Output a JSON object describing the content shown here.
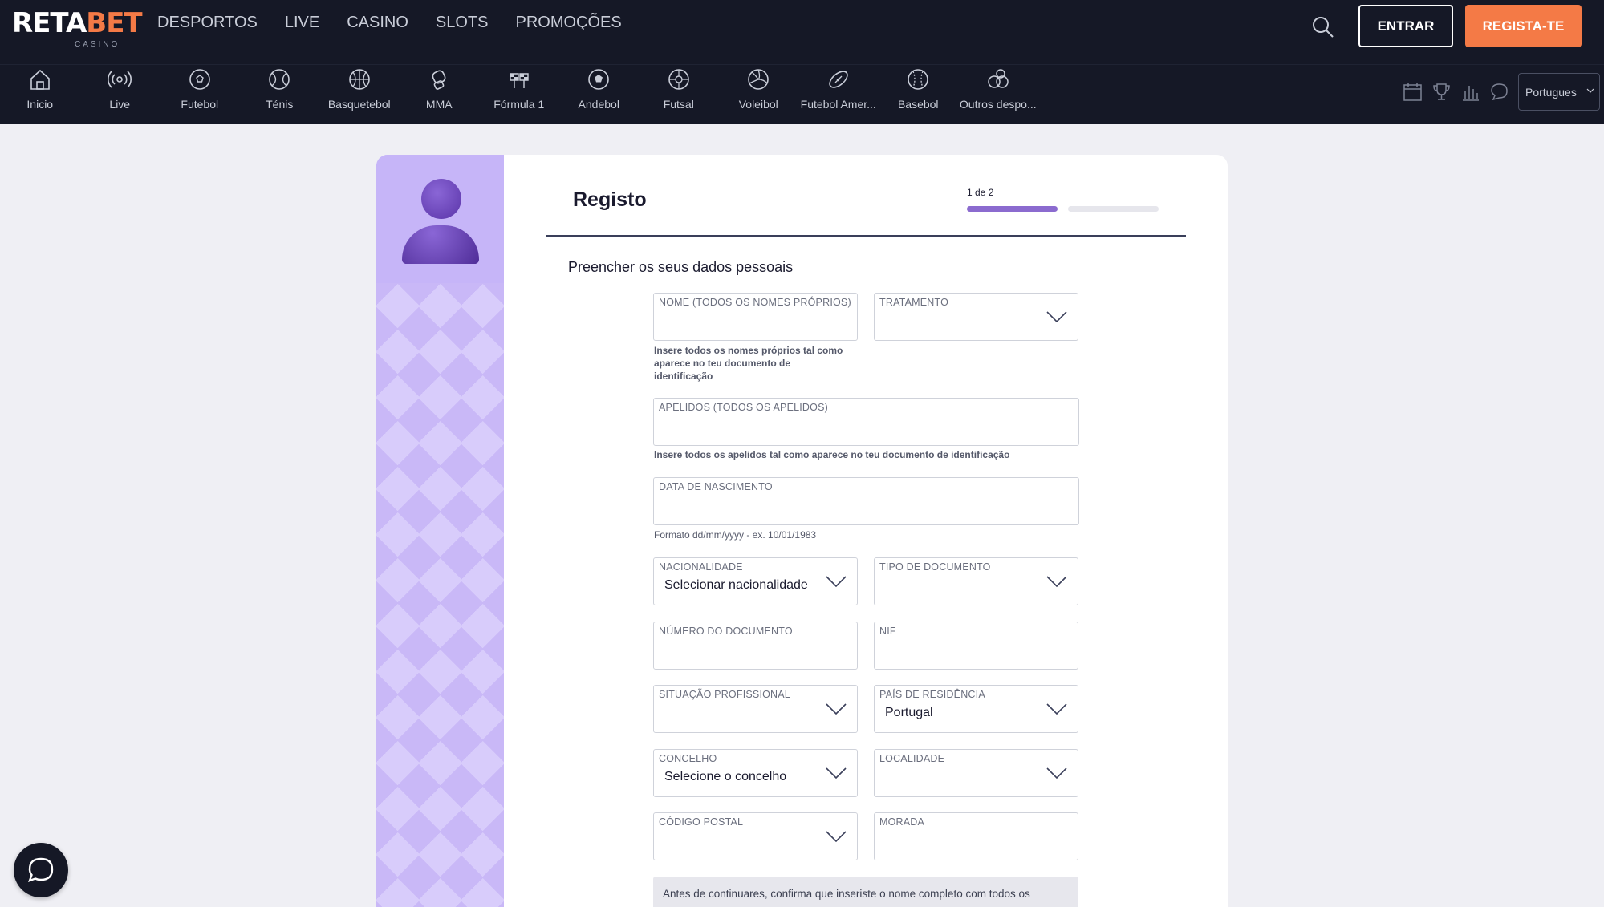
{
  "brand": {
    "name_part1": "RETA",
    "name_part2": "BET",
    "sub": "CASINO"
  },
  "main_menu": [
    "DESPORTOS",
    "LIVE",
    "CASINO",
    "SLOTS",
    "PROMOÇÕES"
  ],
  "header_buttons": {
    "login": "ENTRAR",
    "register": "REGISTA-TE"
  },
  "sports": [
    {
      "label": "Inicio",
      "icon": "home-icon"
    },
    {
      "label": "Live",
      "icon": "live-broadcast-icon"
    },
    {
      "label": "Futebol",
      "icon": "football-icon"
    },
    {
      "label": "Ténis",
      "icon": "tennis-icon"
    },
    {
      "label": "Basquetebol",
      "icon": "basketball-icon"
    },
    {
      "label": "MMA",
      "icon": "mma-glove-icon"
    },
    {
      "label": "Fórmula 1",
      "icon": "formula1-icon"
    },
    {
      "label": "Andebol",
      "icon": "handball-icon"
    },
    {
      "label": "Futsal",
      "icon": "futsal-icon"
    },
    {
      "label": "Voleibol",
      "icon": "volleyball-icon"
    },
    {
      "label": "Futebol Amer...",
      "icon": "american-football-icon"
    },
    {
      "label": "Basebol",
      "icon": "baseball-icon"
    },
    {
      "label": "Outros despo...",
      "icon": "other-sports-icon"
    }
  ],
  "language": "Portugues",
  "form": {
    "title": "Registo",
    "step": "1 de 2",
    "step_progress": 0.5,
    "subtitle": "Preencher os seus dados pessoais",
    "fields": {
      "nome": {
        "label": "NOME (TODOS OS NOMES PRÓPRIOS)",
        "value": ""
      },
      "tratamento": {
        "label": "TRATAMENTO",
        "value": ""
      },
      "apelidos": {
        "label": "APELIDOS (TODOS OS APELIDOS)",
        "value": ""
      },
      "nascimento": {
        "label": "DATA DE NASCIMENTO",
        "value": ""
      },
      "nacionalidade": {
        "label": "NACIONALIDADE",
        "value": "Selecionar nacionalidade"
      },
      "tipo_documento": {
        "label": "TIPO DE DOCUMENTO",
        "value": ""
      },
      "numero_documento": {
        "label": "NÚMERO DO DOCUMENTO",
        "value": ""
      },
      "nif": {
        "label": "NIF",
        "value": ""
      },
      "situacao": {
        "label": "SITUAÇÃO PROFISSIONAL",
        "value": ""
      },
      "pais": {
        "label": "PAÍS DE RESIDÊNCIA",
        "value": "Portugal"
      },
      "concelho": {
        "label": "CONCELHO",
        "value": "Selecione o concelho"
      },
      "localidade": {
        "label": "LOCALIDADE",
        "value": ""
      },
      "codigo_postal": {
        "label": "CÓDIGO POSTAL",
        "value": ""
      },
      "morada": {
        "label": "MORADA",
        "value": ""
      }
    },
    "hints": {
      "nome_1": "Insere todos os nomes próprios tal como",
      "nome_2": "aparece no teu documento de",
      "nome_3": "identificação",
      "apelidos": "Insere todos os apelidos tal como aparece no teu documento de identificação",
      "nascimento": "Formato dd/mm/yyyy - ex. 10/01/1983"
    },
    "notice": "Antes de continuares, confirma que inseriste o nome completo com todos os"
  },
  "colors": {
    "header_bg": "#151826",
    "accent": "#f47a46",
    "purple": "#8b6bcf",
    "side_panel": "#c3b5f6"
  }
}
